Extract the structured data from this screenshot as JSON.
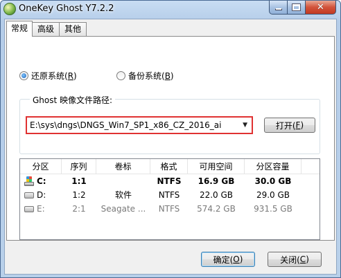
{
  "window": {
    "title": "OneKey Ghost Y7.2.2"
  },
  "tabs": [
    {
      "label": "常规",
      "active": true
    },
    {
      "label": "高级",
      "active": false
    },
    {
      "label": "其他",
      "active": false
    }
  ],
  "radios": {
    "restore": {
      "label": "还原系统(",
      "hotkey": "R",
      "suffix": ")",
      "checked": true
    },
    "backup": {
      "label": "备份系统(",
      "hotkey": "B",
      "suffix": ")",
      "checked": false
    }
  },
  "image_group": {
    "legend": "Ghost 映像文件路径:",
    "path_value": "E:\\sys\\dngs\\DNGS_Win7_SP1_x86_CZ_2016_ai",
    "open_button": {
      "label": "打开(",
      "hotkey": "F",
      "suffix": ")"
    }
  },
  "table": {
    "columns": [
      "分区",
      "序列",
      "卷标",
      "格式",
      "可用空间",
      "分区容量"
    ],
    "rows": [
      {
        "drive": "C:",
        "seq": "1:1",
        "label": "",
        "format": "NTFS",
        "free": "16.9 GB",
        "capacity": "30.0 GB",
        "style": "bold",
        "icon": "system-drive-icon"
      },
      {
        "drive": "D:",
        "seq": "1:2",
        "label": "软件",
        "format": "NTFS",
        "free": "22.0 GB",
        "capacity": "29.0 GB",
        "style": "normal",
        "icon": "drive-icon"
      },
      {
        "drive": "E:",
        "seq": "2:1",
        "label": "Seagate ...",
        "format": "NTFS",
        "free": "574.2 GB",
        "capacity": "931.5 GB",
        "style": "dim",
        "icon": "drive-icon"
      }
    ]
  },
  "footer": {
    "ok": {
      "label": "确定(",
      "hotkey": "O",
      "suffix": ")"
    },
    "close": {
      "label": "关闭(",
      "hotkey": "C",
      "suffix": ")"
    }
  }
}
